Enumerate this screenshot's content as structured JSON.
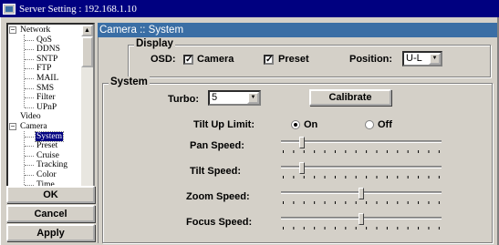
{
  "window": {
    "title": "Server Setting : 192.168.1.10"
  },
  "tree": {
    "items": [
      {
        "label": "Network",
        "level": 0,
        "expander": "−"
      },
      {
        "label": "QoS",
        "level": 1
      },
      {
        "label": "DDNS",
        "level": 1
      },
      {
        "label": "SNTP",
        "level": 1
      },
      {
        "label": "FTP",
        "level": 1
      },
      {
        "label": "MAIL",
        "level": 1
      },
      {
        "label": "SMS",
        "level": 1
      },
      {
        "label": "Filter",
        "level": 1
      },
      {
        "label": "UPnP",
        "level": 1
      },
      {
        "label": "Video",
        "level": 0
      },
      {
        "label": "Camera",
        "level": 0,
        "expander": "−"
      },
      {
        "label": "System",
        "level": 1,
        "selected": true
      },
      {
        "label": "Preset",
        "level": 1
      },
      {
        "label": "Cruise",
        "level": 1
      },
      {
        "label": "Tracking",
        "level": 1
      },
      {
        "label": "Color",
        "level": 1
      },
      {
        "label": "Time",
        "level": 1
      }
    ]
  },
  "buttons": {
    "ok": "OK",
    "cancel": "Cancel",
    "apply": "Apply"
  },
  "panel": {
    "title": "Camera :: System"
  },
  "display": {
    "legend": "Display",
    "osd_label": "OSD:",
    "camera_label": "Camera",
    "camera_checked": "✓",
    "preset_label": "Preset",
    "preset_checked": "✓",
    "position_label": "Position:",
    "position_value": "U-L"
  },
  "system": {
    "legend": "System",
    "turbo_label": "Turbo:",
    "turbo_value": "5",
    "calibrate_label": "Calibrate",
    "tilt_limit_label": "Tilt Up Limit:",
    "tilt_on_label": "On",
    "tilt_off_label": "Off",
    "pan_speed_label": "Pan Speed:",
    "tilt_speed_label": "Tilt Speed:",
    "zoom_speed_label": "Zoom Speed:",
    "focus_speed_label": "Focus Speed:",
    "pan_speed_level": 0.12,
    "tilt_speed_level": 0.12,
    "zoom_speed_level": 0.5,
    "focus_speed_level": 0.5
  },
  "colors": {
    "title_bar": "#000080",
    "panel_header": "#3a6ea5",
    "face": "#d4d0c8"
  },
  "icons": {
    "app": "app-icon",
    "scroll_up": "arrow-up-icon",
    "scroll_down": "arrow-down-icon",
    "dropdown": "chevron-down-icon"
  }
}
